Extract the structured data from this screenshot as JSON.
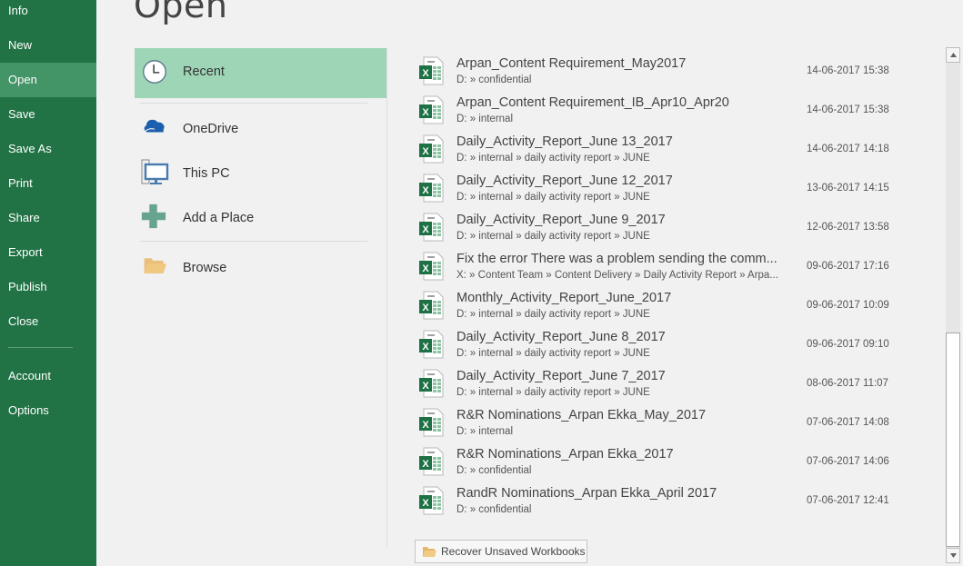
{
  "nav": {
    "items": [
      {
        "label": "Info"
      },
      {
        "label": "New"
      },
      {
        "label": "Open",
        "active": true
      },
      {
        "label": "Save"
      },
      {
        "label": "Save As"
      },
      {
        "label": "Print"
      },
      {
        "label": "Share"
      },
      {
        "label": "Export"
      },
      {
        "label": "Publish"
      },
      {
        "label": "Close"
      },
      {
        "label": "Account"
      },
      {
        "label": "Options"
      }
    ]
  },
  "page": {
    "title": "Open"
  },
  "places": [
    {
      "label": "Recent",
      "icon": "clock-icon",
      "active": true
    },
    {
      "label": "OneDrive",
      "icon": "onedrive-cloud-icon"
    },
    {
      "label": "This PC",
      "icon": "computer-icon"
    },
    {
      "label": "Add a Place",
      "icon": "plus-icon"
    },
    {
      "label": "Browse",
      "icon": "folder-icon"
    }
  ],
  "recent_files": [
    {
      "name": "Arpan_Content Requirement_May2017",
      "path": "D: » confidential",
      "modified": "14-06-2017 15:38"
    },
    {
      "name": "Arpan_Content Requirement_IB_Apr10_Apr20",
      "path": "D: » internal",
      "modified": "14-06-2017 15:38"
    },
    {
      "name": "Daily_Activity_Report_June 13_2017",
      "path": "D: » internal » daily activity report » JUNE",
      "modified": "14-06-2017 14:18"
    },
    {
      "name": "Daily_Activity_Report_June 12_2017",
      "path": "D: » internal » daily activity report » JUNE",
      "modified": "13-06-2017 14:15"
    },
    {
      "name": "Daily_Activity_Report_June 9_2017",
      "path": "D: » internal » daily activity report » JUNE",
      "modified": "12-06-2017 13:58"
    },
    {
      "name": "Fix the error There was a problem sending the comm...",
      "path": "X: » Content Team » Content Delivery » Daily Activity Report » Arpa...",
      "modified": "09-06-2017 17:16"
    },
    {
      "name": "Monthly_Activity_Report_June_2017",
      "path": "D: » internal » daily activity report » JUNE",
      "modified": "09-06-2017 10:09"
    },
    {
      "name": "Daily_Activity_Report_June 8_2017",
      "path": "D: » internal » daily activity report » JUNE",
      "modified": "09-06-2017 09:10"
    },
    {
      "name": "Daily_Activity_Report_June 7_2017",
      "path": "D: » internal » daily activity report » JUNE",
      "modified": "08-06-2017 11:07"
    },
    {
      "name": "R&R Nominations_Arpan Ekka_May_2017",
      "path": "D: » internal",
      "modified": "07-06-2017 14:08"
    },
    {
      "name": "R&R Nominations_Arpan Ekka_2017",
      "path": "D: » confidential",
      "modified": "07-06-2017 14:06"
    },
    {
      "name": "RandR Nominations_Arpan Ekka_April 2017",
      "path": "D: » confidential",
      "modified": "07-06-2017 12:41"
    }
  ],
  "recover_button": {
    "label": "Recover Unsaved Workbooks",
    "icon": "folder-icon"
  },
  "colors": {
    "nav_bg": "#217346",
    "nav_active": "#439467",
    "place_active": "#9fd5b7",
    "excel_green": "#1e7145"
  }
}
